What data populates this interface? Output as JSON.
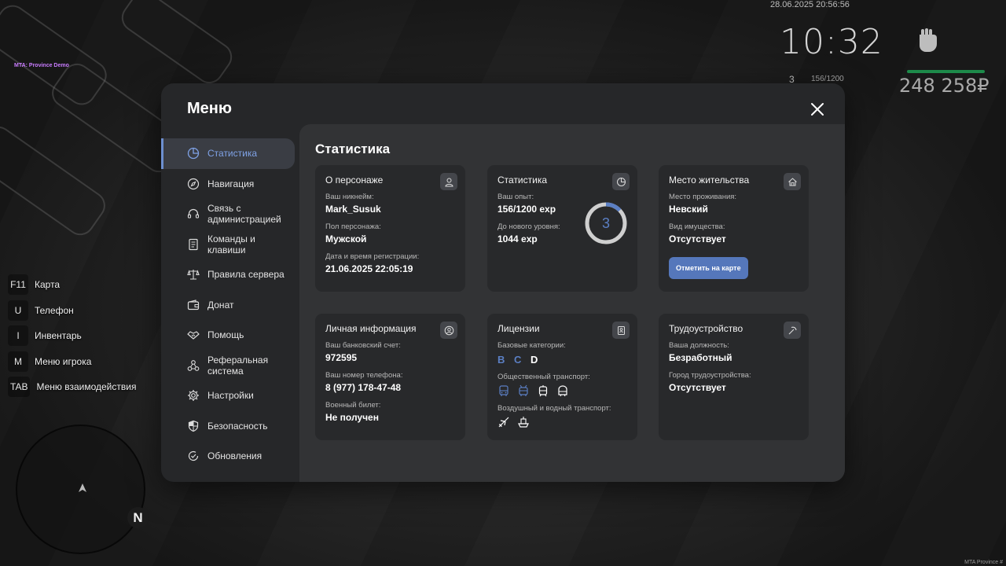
{
  "hud": {
    "datetime": "28.06.2025 20:56:56",
    "time": "10:32",
    "level": "3",
    "exp": "156/1200",
    "money": "248 258₽",
    "server_tag": "MTA: Province Demo",
    "corner_tag": "MTA Province #"
  },
  "hints": [
    {
      "key": "F11",
      "label": "Карта"
    },
    {
      "key": "U",
      "label": "Телефон"
    },
    {
      "key": "I",
      "label": "Инвентарь"
    },
    {
      "key": "M",
      "label": "Меню игрока"
    },
    {
      "key": "TAB",
      "label": "Меню взаимодействия"
    }
  ],
  "minimap": {
    "north": "N"
  },
  "menu": {
    "title": "Меню",
    "sidebar": [
      {
        "label": "Статистика",
        "icon": "pie-chart-icon"
      },
      {
        "label": "Навигация",
        "icon": "compass-icon"
      },
      {
        "label": "Связь с администрацией",
        "icon": "headset-icon"
      },
      {
        "label": "Команды и клавиши",
        "icon": "document-icon"
      },
      {
        "label": "Правила сервера",
        "icon": "scales-icon"
      },
      {
        "label": "Донат",
        "icon": "wallet-icon"
      },
      {
        "label": "Помощь",
        "icon": "handshake-icon"
      },
      {
        "label": "Реферальная система",
        "icon": "network-icon"
      },
      {
        "label": "Настройки",
        "icon": "gear-icon"
      },
      {
        "label": "Безопасность",
        "icon": "shield-icon"
      },
      {
        "label": "Обновления",
        "icon": "update-icon"
      }
    ],
    "section_title": "Статистика",
    "cards": {
      "character": {
        "title": "О персонаже",
        "nickname_label": "Ваш никнейм:",
        "nickname": "Mark_Susuk",
        "gender_label": "Пол персонажа:",
        "gender": "Мужской",
        "reg_label": "Дата и время регистрации:",
        "reg": "21.06.2025 22:05:19"
      },
      "stats": {
        "title": "Статистика",
        "exp_label": "Ваш опыт:",
        "exp": "156/1200 exp",
        "next_label": "До нового уровня:",
        "next": "1044 exp",
        "level": "3",
        "progress": 0.13
      },
      "residence": {
        "title": "Место жительства",
        "place_label": "Место проживания:",
        "place": "Невский",
        "property_label": "Вид имущества:",
        "property": "Отсутствует",
        "map_button": "Отметить на карте"
      },
      "personal": {
        "title": "Личная информация",
        "bank_label": "Ваш банковский счет:",
        "bank": "972595",
        "phone_label": "Ваш номер телефона:",
        "phone": "8 (977) 178-47-48",
        "military_label": "Военный билет:",
        "military": "Не получен"
      },
      "licenses": {
        "title": "Лицензии",
        "base_label": "Базовые категории:",
        "categories": [
          {
            "letter": "B",
            "color": "#5b7fc4"
          },
          {
            "letter": "C",
            "color": "#5b7fc4"
          },
          {
            "letter": "D",
            "color": "#ffffff"
          }
        ],
        "public_label": "Общественный транспорт:",
        "air_label": "Воздушный и водный транспорт:"
      },
      "job": {
        "title": "Трудоустройство",
        "position_label": "Ваша должность:",
        "position": "Безработный",
        "city_label": "Город трудоустройства:",
        "city": "Отсутствует"
      }
    }
  },
  "colors": {
    "accent": "#5b7fc4",
    "card": "#28292b",
    "panel": "#262729",
    "content": "#323335"
  }
}
